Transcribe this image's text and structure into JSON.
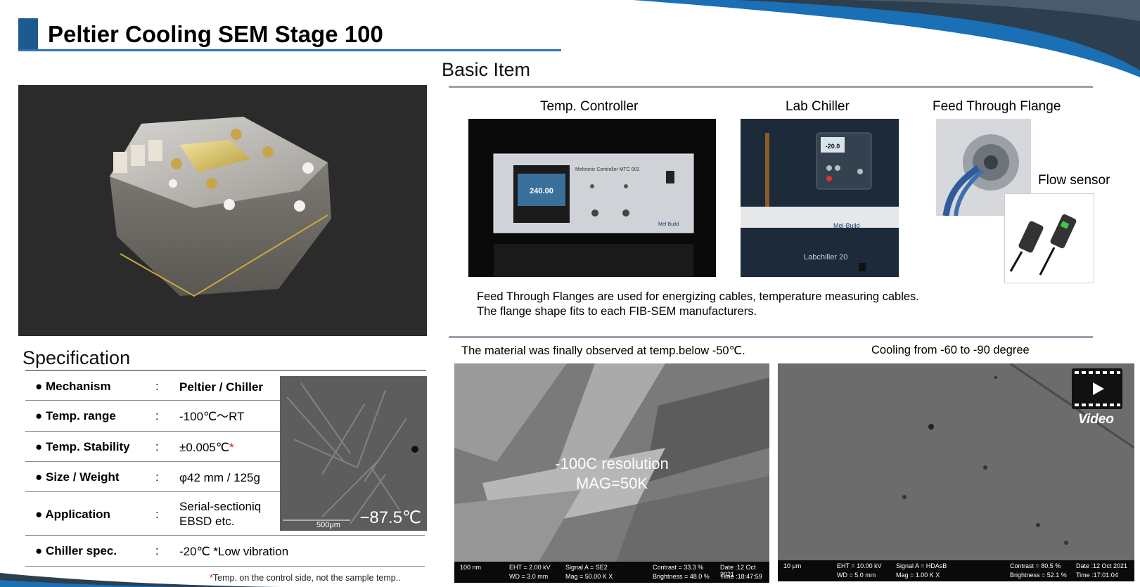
{
  "title": "Peltier Cooling SEM Stage 100",
  "colors": {
    "accent": "#1f5a8f",
    "underline": "#2e75b6",
    "swoosh_dark": "#2d3e4e",
    "swoosh_blue": "#1a6fb5"
  },
  "specification": {
    "heading": "Specification",
    "rows": [
      {
        "name": "● Mechanism",
        "colon": ":",
        "value": "Peltier / Chiller",
        "bold_value": true
      },
      {
        "name": "● Temp.  range",
        "colon": ":",
        "value": "-100℃～RT"
      },
      {
        "name": "● Temp. Stability",
        "colon": ":",
        "value": "±0.005℃",
        "mark": "*"
      },
      {
        "name": "● Size / Weight",
        "colon": ":",
        "value": "φ42 mm / 125g"
      },
      {
        "name": "● Application",
        "colon": ":",
        "value_line1": "Serial-sectioniq",
        "value_line2": "EBSD etc."
      },
      {
        "name": "● Chiller spec.",
        "colon": ":",
        "value": "-20℃ *Low vibration"
      }
    ],
    "inset_temp": "−87.5℃",
    "inset_scale": "500μm",
    "footnote_mark": "*",
    "footnote": "Temp. on the control side, not the sample temp.."
  },
  "basic_item": {
    "heading": "Basic Item",
    "items": [
      {
        "label": "Temp. Controller",
        "screen_value": "240.00",
        "panel_text": "Meltronic Controller MTC 002",
        "brand": "Mel-Build"
      },
      {
        "label": "Lab Chiller",
        "display_value": "-20.0",
        "brand": "Mel-Build",
        "model": "Labchiller 20"
      },
      {
        "label": "Feed Through Flange"
      },
      {
        "label": "Flow sensor"
      }
    ],
    "description_line1": "Feed Through Flanges are used for energizing cables, temperature measuring cables.",
    "description_line2": "The flange shape fits to each FIB-SEM manufacturers."
  },
  "observations": [
    {
      "caption": "The material was finally observed at temp.below -50℃.",
      "overlay_line1": "-100C resolution",
      "overlay_line2": "MAG=50K",
      "bar": {
        "scale": "100 nm",
        "eht": "EHT =  2.00 kV",
        "wd": "WD =  3.0 mm",
        "signal": "Signal A = SE2",
        "mag": "Mag =   50.00 K X",
        "date": "Date :12 Oct 2021",
        "time": "Time :18:47:59",
        "contrast": "Contrast =  33.3 %",
        "brightness": "Brightness =  48.0 %"
      }
    },
    {
      "caption": "Cooling from -60 to -90 degree",
      "video_label": "Video",
      "bar": {
        "scale": "10 μm",
        "eht": "EHT = 10.00 kV",
        "wd": "WD =  5.0 mm",
        "signal": "Signal A = HDAsB",
        "mag": "Mag =     1.00 K X",
        "date": "Date :12 Oct 2021",
        "time": "Time :17:01:04",
        "contrast": "Contrast =  80.5 %",
        "brightness": "Brightness =  52.1 %"
      }
    }
  ]
}
